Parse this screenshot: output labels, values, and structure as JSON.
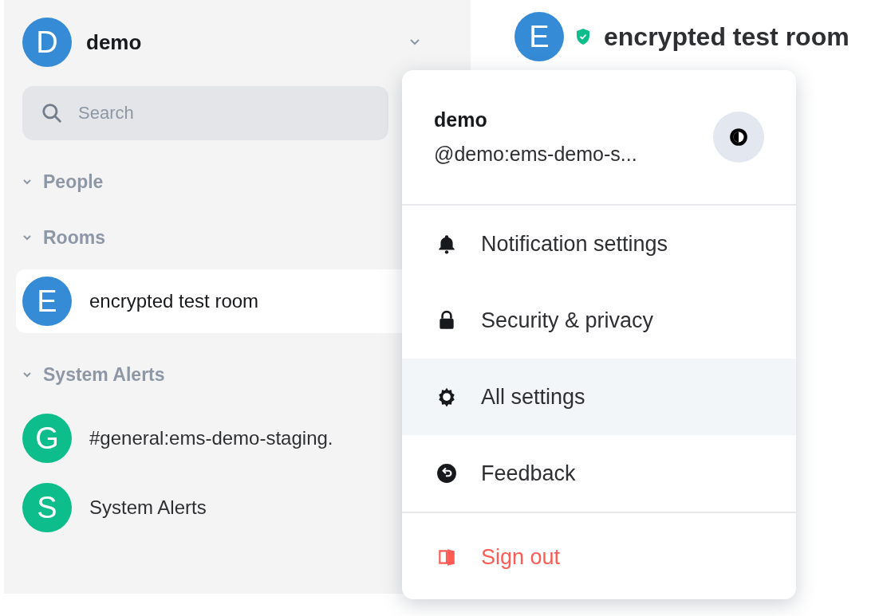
{
  "account": {
    "avatar": "D",
    "name": "demo",
    "color": "#368bd6"
  },
  "search": {
    "placeholder": "Search"
  },
  "sections": [
    {
      "title": "People",
      "expanded": true
    },
    {
      "title": "Rooms",
      "expanded": true,
      "rooms": [
        {
          "avatar": "E",
          "name": "encrypted test room",
          "color": "#368bd6",
          "selected": true
        }
      ]
    },
    {
      "title": "System Alerts",
      "expanded": true,
      "rooms": [
        {
          "avatar": "G",
          "name": "#general:ems-demo-staging.",
          "color": "#0dbd8b",
          "selected": false
        },
        {
          "avatar": "S",
          "name": "System Alerts",
          "color": "#0dbd8b",
          "selected": false
        }
      ]
    }
  ],
  "room_header": {
    "avatar": "E",
    "title": "encrypted test room",
    "color": "#368bd6",
    "encrypted": true
  },
  "user_menu": {
    "display_name": "demo",
    "user_id": "@demo:ems-demo-s...",
    "groups": [
      {
        "items": [
          {
            "label": "Notification settings",
            "kind": "bell",
            "selected": false
          },
          {
            "label": "Security & privacy",
            "kind": "lock",
            "selected": false
          },
          {
            "label": "All settings",
            "kind": "gear",
            "selected": true
          },
          {
            "label": "Feedback",
            "kind": "feedback",
            "selected": false
          }
        ]
      },
      {
        "items": [
          {
            "label": "Sign out",
            "kind": "signout",
            "selected": false
          }
        ]
      }
    ]
  }
}
